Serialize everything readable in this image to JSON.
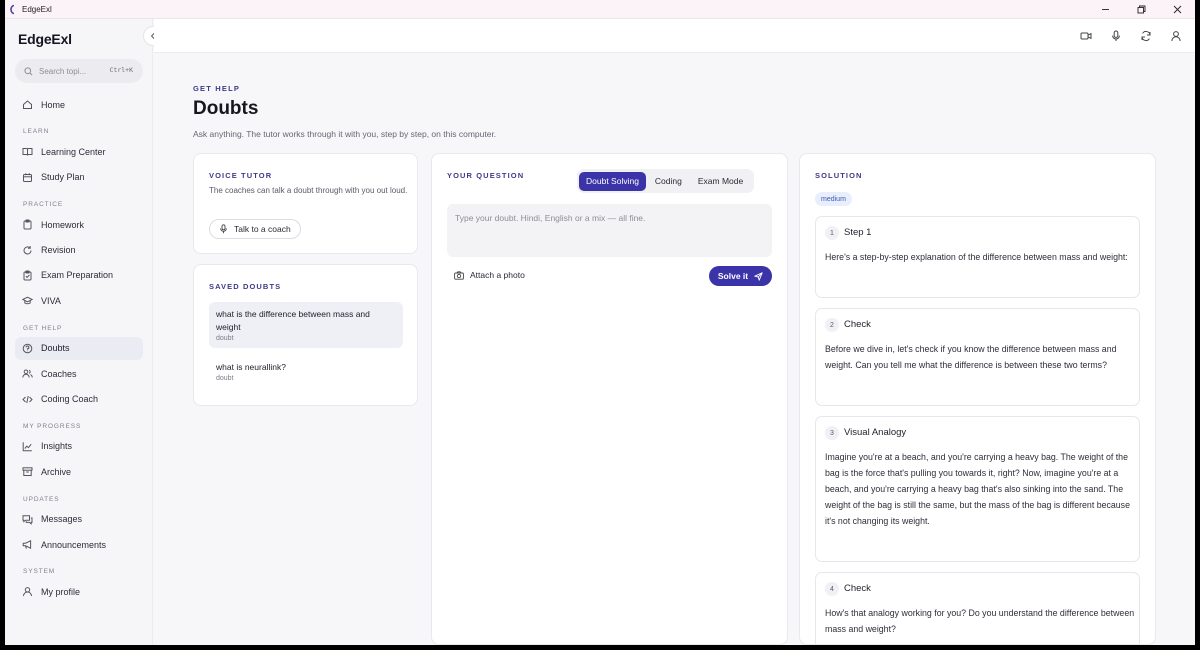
{
  "window": {
    "title": "EdgeExl"
  },
  "sidebar": {
    "brand": "EdgeExl",
    "search_placeholder": "Search topi...",
    "search_shortcut": "Ctrl+K",
    "items": [
      {
        "type": "item",
        "label": "Home",
        "icon": "home-icon"
      },
      {
        "type": "section",
        "label": "LEARN"
      },
      {
        "type": "item",
        "label": "Learning Center",
        "icon": "book-icon"
      },
      {
        "type": "item",
        "label": "Study Plan",
        "icon": "calendar-icon"
      },
      {
        "type": "section",
        "label": "PRACTICE"
      },
      {
        "type": "item",
        "label": "Homework",
        "icon": "clipboard-icon"
      },
      {
        "type": "item",
        "label": "Revision",
        "icon": "refresh-icon"
      },
      {
        "type": "item",
        "label": "Exam Preparation",
        "icon": "clipboard-check-icon"
      },
      {
        "type": "item",
        "label": "VIVA",
        "icon": "graduation-cap-icon"
      },
      {
        "type": "section",
        "label": "GET HELP"
      },
      {
        "type": "item",
        "label": "Doubts",
        "icon": "help-circle-icon",
        "active": true
      },
      {
        "type": "item",
        "label": "Coaches",
        "icon": "users-icon"
      },
      {
        "type": "item",
        "label": "Coding Coach",
        "icon": "code-icon"
      },
      {
        "type": "section",
        "label": "MY PROGRESS"
      },
      {
        "type": "item",
        "label": "Insights",
        "icon": "chart-icon"
      },
      {
        "type": "item",
        "label": "Archive",
        "icon": "archive-icon"
      },
      {
        "type": "section",
        "label": "UPDATES"
      },
      {
        "type": "item",
        "label": "Messages",
        "icon": "messages-icon"
      },
      {
        "type": "item",
        "label": "Announcements",
        "icon": "megaphone-icon"
      },
      {
        "type": "section",
        "label": "SYSTEM"
      },
      {
        "type": "item",
        "label": "My profile",
        "icon": "user-icon"
      }
    ]
  },
  "topbar": {
    "icons": [
      "video-icon",
      "mic-icon",
      "sync-icon",
      "user-icon"
    ]
  },
  "page": {
    "eyebrow": "GET HELP",
    "title": "Doubts",
    "subtitle": "Ask anything. The tutor works through it with you, step by step, on this computer."
  },
  "voice": {
    "label": "VOICE TUTOR",
    "description": "The coaches can talk a doubt through with you out loud.",
    "button": "Talk to a coach"
  },
  "saved": {
    "label": "SAVED DOUBTS",
    "items": [
      {
        "question": "what is the difference between mass and weight",
        "tag": "doubt"
      },
      {
        "question": "what is neurallink?",
        "tag": "doubt"
      }
    ]
  },
  "question": {
    "label": "YOUR QUESTION",
    "modes": [
      "Doubt Solving",
      "Coding",
      "Exam Mode"
    ],
    "active_mode": "Doubt Solving",
    "placeholder": "Type your doubt. Hindi, English or a mix — all fine.",
    "attach": "Attach a photo",
    "solve": "Solve it"
  },
  "solution": {
    "label": "SOLUTION",
    "difficulty": "medium",
    "steps": [
      {
        "num": "1",
        "title": "Step 1",
        "body": "Here's a step-by-step explanation of the difference between mass and weight:"
      },
      {
        "num": "2",
        "title": "Check",
        "body": "Before we dive in, let's check if you know the difference between mass and weight. Can you tell me what the difference is between these two terms?"
      },
      {
        "num": "3",
        "title": "Visual Analogy",
        "body": "Imagine you're at a beach, and you're carrying a heavy bag. The weight of the bag is the force that's pulling you towards it, right? Now, imagine you're at a beach, and you're carrying a heavy bag that's also sinking into the sand. The weight of the bag is still the same, but the mass of the bag is different because it's not changing its weight."
      },
      {
        "num": "4",
        "title": "Check",
        "body": "How's that analogy working for you? Do you understand the difference between mass and weight?"
      }
    ]
  },
  "colors": {
    "accent": "#3b34a8",
    "label": "#3e3a8a",
    "badge_bg": "#e8eefc",
    "badge_text": "#3b5ab8"
  }
}
